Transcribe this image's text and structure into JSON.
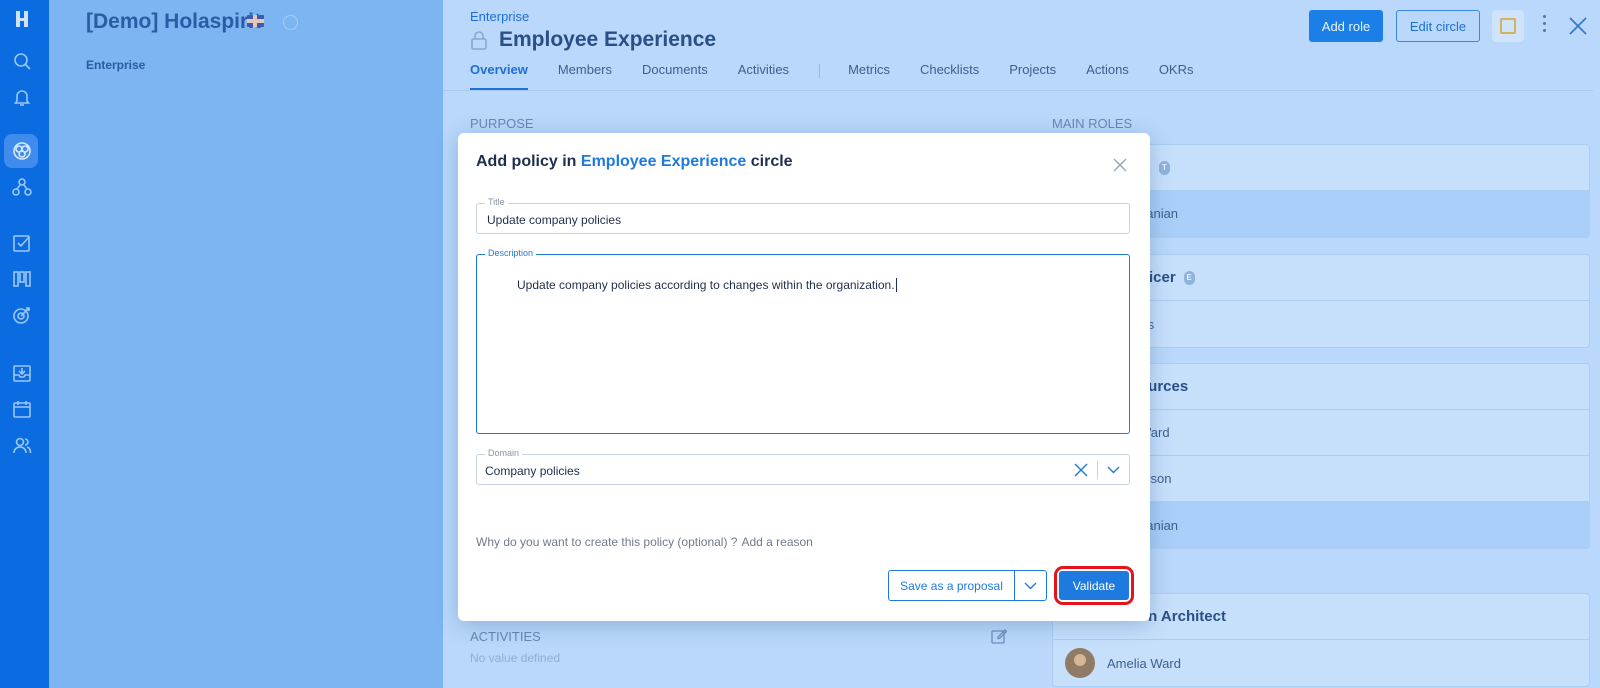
{
  "org": {
    "title": "[Demo] Holaspirit",
    "enterprise": "Enterprise"
  },
  "rail": {
    "icons": [
      "holaspirit-logo-icon",
      "search-icon",
      "bell-icon",
      "circles-icon",
      "org-chart-icon",
      "checkbox-icon",
      "kanban-icon",
      "target-icon",
      "inbox-icon",
      "calendar-icon",
      "people-icon"
    ]
  },
  "circle": {
    "breadcrumb": "Enterprise",
    "title": "Employee Experience",
    "add_role": "Add role",
    "edit_circle": "Edit circle",
    "tabs": [
      "Overview",
      "Members",
      "Documents",
      "Activities",
      "Metrics",
      "Checklists",
      "Projects",
      "Actions",
      "OKRs"
    ],
    "purpose_label": "PURPOSE",
    "main_roles_label": "MAIN ROLES",
    "activities_label": "ACTIVITIES",
    "no_value": "No value defined"
  },
  "roles": {
    "card1_row": "hanian",
    "card2_title": "fficer",
    "card2_badge": "E",
    "card2_person": "llis",
    "card3_title": "ources",
    "card3_p1": "Ward",
    "card3_p2": "erson",
    "card3_p3": "hanian",
    "card1_badge": "T",
    "card4_title": "on Architect",
    "card4_person": "Amelia Ward"
  },
  "modal": {
    "title_prefix": "Add policy in ",
    "title_circle": "Employee Experience",
    "title_suffix": " circle",
    "title_label": "Title",
    "title_value": "Update company policies",
    "description_label": "Description",
    "description_value": "Update company policies according to changes within the organization.",
    "domain_label": "Domain",
    "domain_value": "Company policies",
    "reason_text": "Why do you want to create this policy (optional) ?",
    "reason_link": "Add a reason",
    "save_proposal": "Save as a proposal",
    "validate": "Validate"
  },
  "colors": {
    "accent": "#1f7ae0",
    "rail": "#0b6be0",
    "highlight_ring": "#e3141b"
  }
}
